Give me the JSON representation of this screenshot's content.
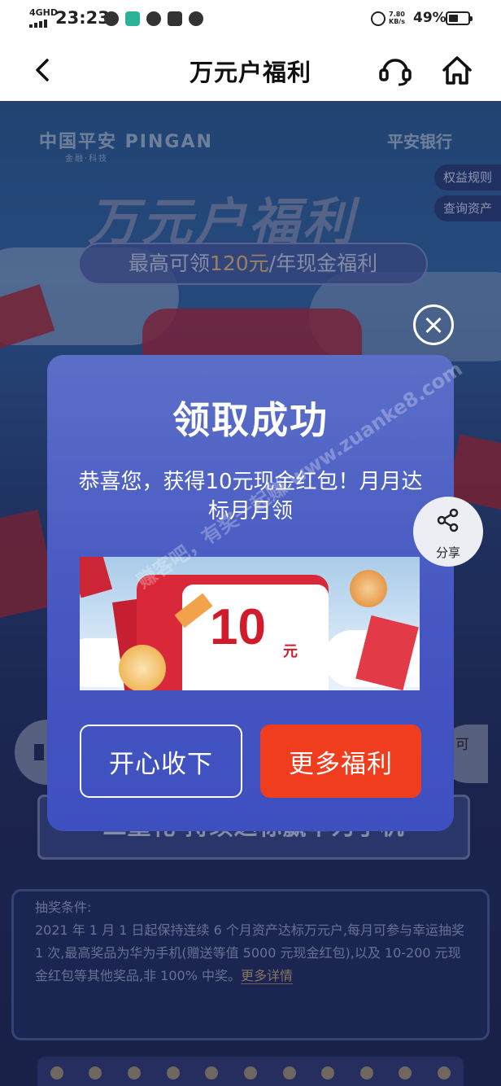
{
  "status_bar": {
    "network": "4GHD",
    "time": "23:23",
    "speed_value": "7.80",
    "speed_unit": "KB/s",
    "battery_pct": "49%",
    "battery_level": 0.49
  },
  "nav": {
    "title": "万元户福利",
    "icons": {
      "back": "chevron-left-icon",
      "service": "headset-icon",
      "home": "home-icon"
    }
  },
  "background": {
    "logo_cn": "中国平安 PINGAN",
    "logo_sub": "金融·科技",
    "bank": "平安银行",
    "side_buttons": [
      "权益规则",
      "查询资产"
    ],
    "hero_title": "万元户福利",
    "hero_banner_prefix": "最高可领",
    "hero_banner_amount": "120元",
    "hero_banner_suffix": "/年现金福利",
    "right_pill_text": "可",
    "second_gift": "二重礼 持续达标赢华为手机",
    "rules_heading": "抽奖条件:",
    "rules_body": "2021 年 1 月 1 日起保持连续 6 个月资产达标万元户,每月可参与幸运抽奖 1 次,最高奖品为华为手机(赠送等值 5000 元现金红包),以及 10-200 元现金红包等其他奖品,非 100% 中奖。",
    "rules_more": "更多详情"
  },
  "dialog": {
    "title": "领取成功",
    "message": "恭喜您，获得10元现金红包！月月达标月月领",
    "prize_amount": "10",
    "prize_unit": "元",
    "btn_accept": "开心收下",
    "btn_more": "更多福利"
  },
  "share": {
    "label": "分享",
    "icon": "share-icon"
  },
  "close": {
    "icon": "close-icon"
  },
  "watermark": "赚客吧，有奖一起赚  www.zuanke8.com",
  "colors": {
    "dialog": "#4a5cc4",
    "primary_button": "#f03d1e",
    "prize_red": "#d21b2a"
  }
}
